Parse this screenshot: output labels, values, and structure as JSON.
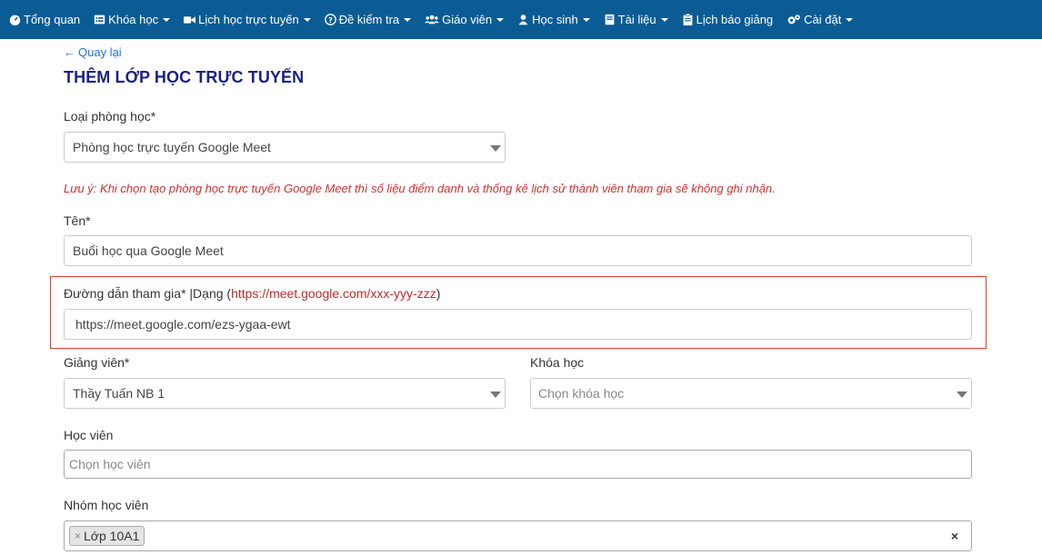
{
  "nav": {
    "items": [
      {
        "label": "Tổng quan",
        "icon": "dashboard-icon",
        "caret": false
      },
      {
        "label": "Khóa học",
        "icon": "list-icon",
        "caret": true
      },
      {
        "label": "Lịch học trực tuyến",
        "icon": "video-icon",
        "caret": true
      },
      {
        "label": "Đề kiểm tra",
        "icon": "question-icon",
        "caret": true
      },
      {
        "label": "Giáo viên",
        "icon": "users-icon",
        "caret": true
      },
      {
        "label": "Học sinh",
        "icon": "user-icon",
        "caret": true
      },
      {
        "label": "Tài liệu",
        "icon": "book-icon",
        "caret": true
      },
      {
        "label": "Lịch báo giảng",
        "icon": "clipboard-icon",
        "caret": false
      },
      {
        "label": "Cài đặt",
        "icon": "cogs-icon",
        "caret": true
      }
    ],
    "background": "#0b5c94"
  },
  "back": {
    "label": "Quay lại"
  },
  "title": "THÊM LỚP HỌC TRỰC TUYẾN",
  "form": {
    "room_type": {
      "label": "Loại phòng học*",
      "value": "Phòng học trực tuyến Google Meet"
    },
    "note": "Lưu ý: Khi chọn tạo phòng học trực tuyến Google Meet thì số liệu điểm danh và thống kê lịch sử thành viên tham gia sẽ không ghi nhận.",
    "name": {
      "label": "Tên*",
      "value": "Buổi học qua Google Meet"
    },
    "join_link": {
      "label_prefix": "Đường dẫn tham gia* |Dạng (",
      "label_example": "https://meet.google.com/xxx-yyy-zzz",
      "label_suffix": ")",
      "value": "https://meet.google.com/ezs-ygaa-ewt"
    },
    "teacher": {
      "label": "Giảng viên*",
      "value": "Thầy Tuấn NB 1"
    },
    "course": {
      "label": "Khóa học",
      "placeholder": "Chọn khóa học"
    },
    "student": {
      "label": "Học viên",
      "placeholder": "Chọn học viên"
    },
    "student_group": {
      "label": "Nhóm học viên",
      "chips": [
        "Lớp 10A1"
      ],
      "clear": "×",
      "chip_remove": "×"
    }
  },
  "colors": {
    "title": "#1a237e",
    "note": "#d32f2f",
    "highlight": "#e53935",
    "link": "#1a73e8"
  }
}
